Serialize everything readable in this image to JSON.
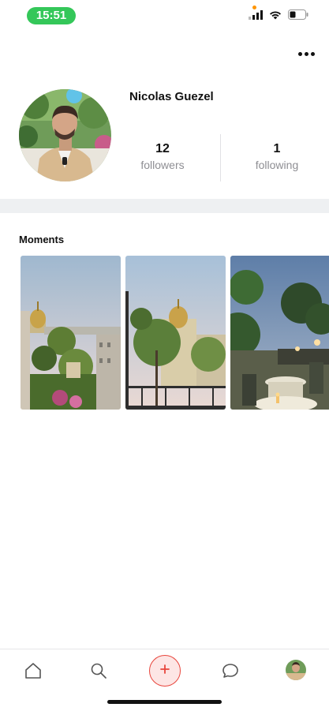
{
  "status_bar": {
    "time": "15:51",
    "icons": [
      "cellular-signal-icon",
      "wifi-icon",
      "battery-icon"
    ],
    "time_pill_color": "#34c759"
  },
  "header": {
    "more_icon": "ellipsis-icon"
  },
  "profile": {
    "name": "Nicolas Guezel",
    "followers_count": "12",
    "followers_label": "followers",
    "following_count": "1",
    "following_label": "following"
  },
  "moments": {
    "title": "Moments",
    "items": [
      {
        "scene": "rooftop-garden-dome"
      },
      {
        "scene": "tree-balcony-dome"
      },
      {
        "scene": "terrace-restaurant-evening"
      }
    ]
  },
  "bottom_nav": {
    "items": [
      "home-icon",
      "search-icon",
      "add-icon",
      "chat-icon",
      "profile-avatar"
    ],
    "accent_color": "#e8453c"
  }
}
